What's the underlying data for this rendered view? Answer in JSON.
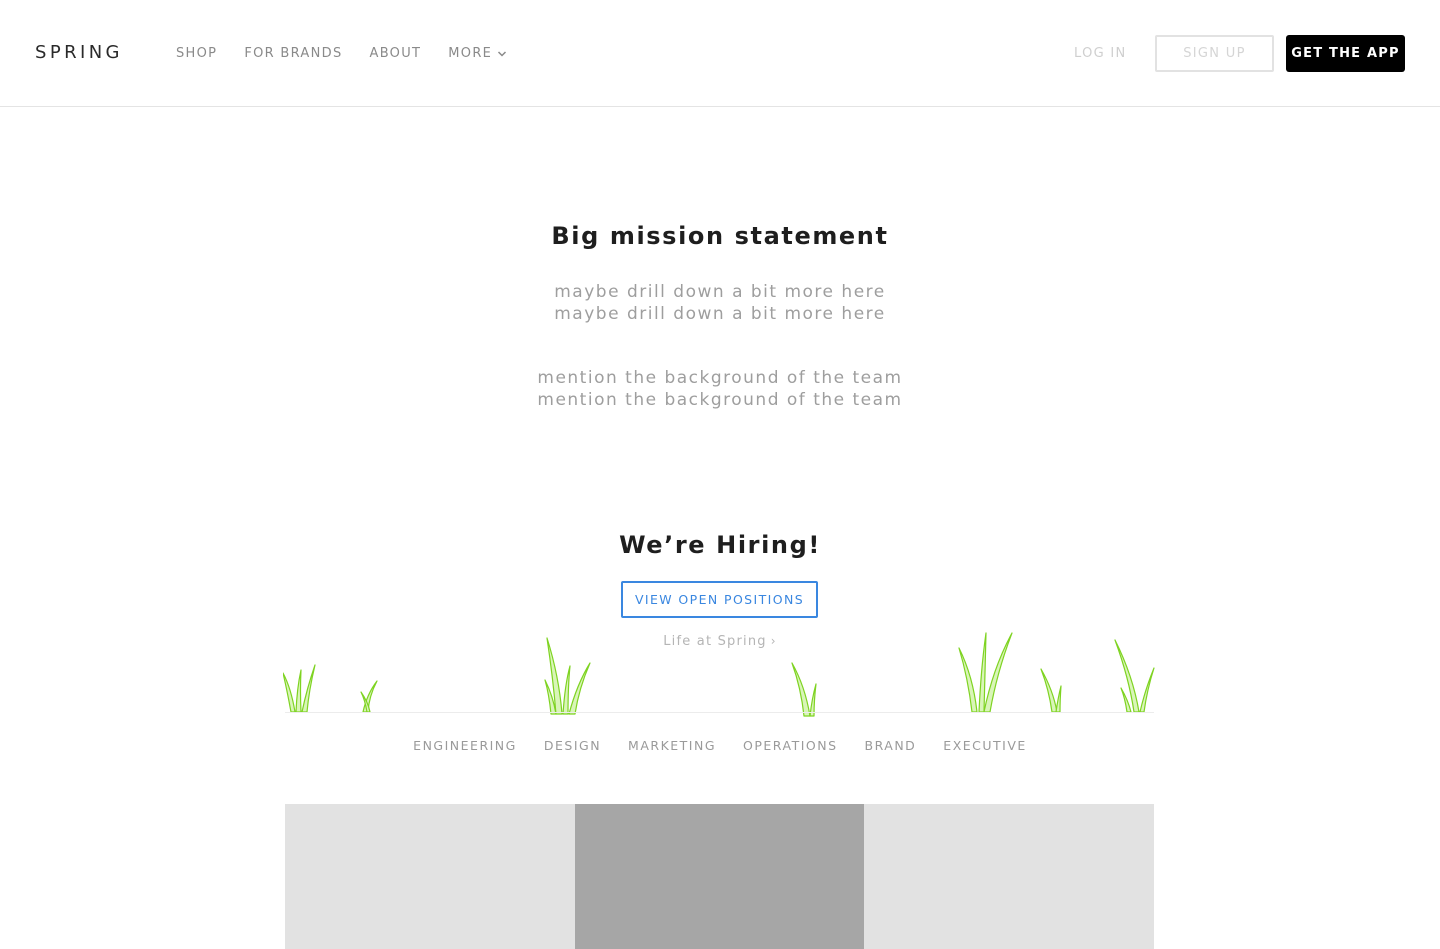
{
  "header": {
    "logo": "SPRING",
    "nav": [
      {
        "label": "SHOP"
      },
      {
        "label": "FOR BRANDS"
      },
      {
        "label": "ABOUT"
      },
      {
        "label": "MORE"
      }
    ],
    "login_label": "LOG IN",
    "signup_label": "SIGN UP",
    "getapp_label": "GET THE APP"
  },
  "mission": {
    "title": "Big mission statement",
    "detail_lines": [
      "maybe drill down a bit more here",
      "maybe drill down a bit more here"
    ],
    "team_lines": [
      "mention the background of the team",
      "mention the background of the team"
    ]
  },
  "hiring": {
    "title": "We’re Hiring!",
    "button_label": "VIEW OPEN POSITIONS",
    "life_link": "Life at Spring"
  },
  "categories": [
    "ENGINEERING",
    "DESIGN",
    "MARKETING",
    "OPERATIONS",
    "BRAND",
    "EXECUTIVE"
  ],
  "colors": {
    "accent_blue": "#3a87e0",
    "grass_green": "#7ed321",
    "tile_light": "#e2e2e2",
    "tile_dark": "#a6a6a6"
  }
}
